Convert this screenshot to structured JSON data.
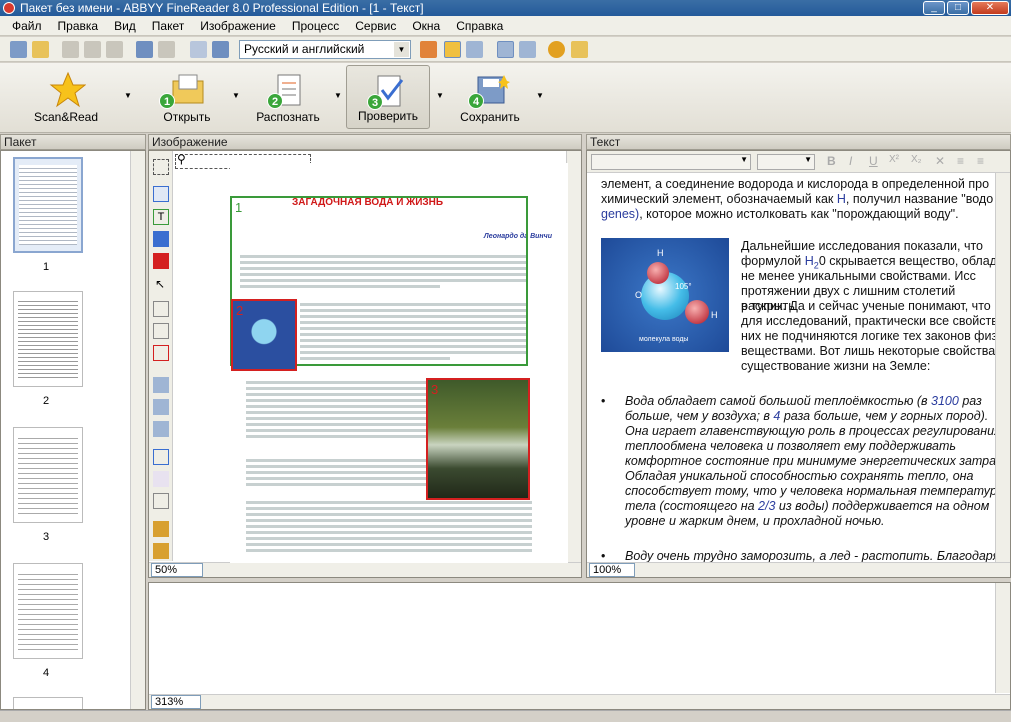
{
  "window": {
    "title": "Пакет без имени - ABBYY FineReader 8.0 Professional Edition - [1 - Текст]"
  },
  "menu": [
    "Файл",
    "Правка",
    "Вид",
    "Пакет",
    "Изображение",
    "Процесс",
    "Сервис",
    "Окна",
    "Справка"
  ],
  "toolbar": {
    "language": "Русский и английский"
  },
  "bigbar": {
    "scan_read": "Scan&Read",
    "open": "Открыть",
    "open_num": "1",
    "recognize": "Распознать",
    "recognize_num": "2",
    "check": "Проверить",
    "check_num": "3",
    "save": "Сохранить",
    "save_num": "4"
  },
  "panes": {
    "packet": "Пакет",
    "image": "Изображение",
    "text": "Текст"
  },
  "packet": {
    "pages": [
      "1",
      "2",
      "3",
      "4"
    ]
  },
  "image": {
    "zoom": "50%",
    "zoom_bottom": "313%",
    "zone1_num": "1",
    "zone2_num": "2",
    "zone3_num": "3",
    "title": "ЗАГАДОЧНАЯ ВОДА И ЖИЗНЬ",
    "author": "Леонардо да Винчи"
  },
  "text": {
    "zoom": "100%",
    "p1_a": "элемент, а соединение водорода и кислорода в определенной про",
    "p1_b": "химический элемент, обозначаемый как",
    "p1_b_h": "H",
    "p1_b2": ", получил название \"водо",
    "p1_c": "genes)",
    "p1_c2": ", которое можно истолковать как \"порождающий воду\".",
    "molecule_caption": "молекула воды",
    "molecule_angle": "105°",
    "molecule_h": "H",
    "molecule_o": "O",
    "p2_1": "Дальнейшие исследования показали, что",
    "p2_2a": "формулой",
    "p2_2b": "H",
    "p2_2c": "2",
    "p2_2d": "0 скрывается вещество, облада",
    "p2_3": "не менее уникальными свойствами. Исс",
    "p2_4": "протяжении двух с лишним столетий раскрыть",
    "p2_5": "в тупик. Да и сейчас ученые понимают, что во",
    "p2_6": "для исследований, практически все свойства",
    "p2_7": "них не подчиняются логике тех законов физи",
    "p2_8": "веществами. Вот лишь некоторые свойства",
    "p2_9": "существование жизни на Земле:",
    "b1_1a": "Вода обладает самой большой теплоёмкостью (в",
    "b1_1b": "3100",
    "b1_1c": "раз",
    "b1_2a": "больше, чем у воздуха; в",
    "b1_2b": "4",
    "b1_2c": "раза больше, чем у горных пород).",
    "b1_3": "Она играет главенствующую роль в процессах регулирования",
    "b1_4": "теплообмена человека и позволяет ему поддерживать",
    "b1_5": "комфортное состояние при минимуме энергетических затрат.",
    "b1_6": "Обладая уникальной способностью сохранять тепло, она",
    "b1_7": "способствует тому, что у человека нормальная температура",
    "b1_8a": "тела (состоящего на",
    "b1_8b": "2/3",
    "b1_8c": "из воды) поддерживается на одном",
    "b1_9": "уровне и жарким днем, и прохладной ночью.",
    "b2_1": "Воду очень трудно заморозить, а лед - растопить. Благодаря"
  },
  "colors": {
    "zone_text": "#3a9a3a",
    "zone_picture": "#d42020",
    "title_red": "#d01818"
  }
}
